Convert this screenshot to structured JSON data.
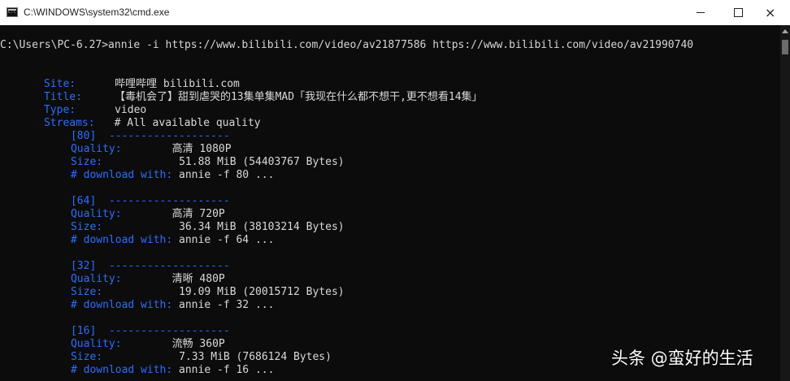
{
  "window": {
    "title": "C:\\WINDOWS\\system32\\cmd.exe"
  },
  "console": {
    "command_line": "C:\\Users\\PC-6.27>annie -i https://www.bilibili.com/video/av21877586 https://www.bilibili.com/video/av21990740",
    "site_label": "Site:",
    "site_value": "哔哩哔哩 bilibili.com",
    "title_label": "Title:",
    "title_value": "【毒机会了】甜到虐哭的13集单集MAD「我现在什么都不想干,更不想看14集」",
    "type_label": "Type:",
    "type_value": "video",
    "streams_label": "Streams:",
    "streams_value": "# All available quality",
    "quality_label": "Quality:",
    "size_label": "Size:",
    "download_label": "# download with:",
    "streams": [
      {
        "id": "[80]",
        "dashes": "-------------------",
        "quality": "高清 1080P",
        "size": "51.88 MiB (54403767 Bytes)",
        "download": "annie -f 80 ..."
      },
      {
        "id": "[64]",
        "dashes": "-------------------",
        "quality": "高清 720P",
        "size": "36.34 MiB (38103214 Bytes)",
        "download": "annie -f 64 ..."
      },
      {
        "id": "[32]",
        "dashes": "-------------------",
        "quality": "清晰 480P",
        "size": "19.09 MiB (20015712 Bytes)",
        "download": "annie -f 32 ..."
      },
      {
        "id": "[16]",
        "dashes": "-------------------",
        "quality": "流畅 360P",
        "size": "7.33 MiB (7686124 Bytes)",
        "download": "annie -f 16 ..."
      }
    ]
  },
  "watermark": {
    "text": "头条 @蛮好的生活"
  },
  "colors": {
    "background": "#0c0c0c",
    "text": "#d5d5d5",
    "label_blue": "#2f6cff",
    "titlebar": "#ffffff"
  },
  "icons": {
    "app": "cmd-icon",
    "minimize": "minimize-icon",
    "maximize": "maximize-icon",
    "close": "close-icon"
  }
}
